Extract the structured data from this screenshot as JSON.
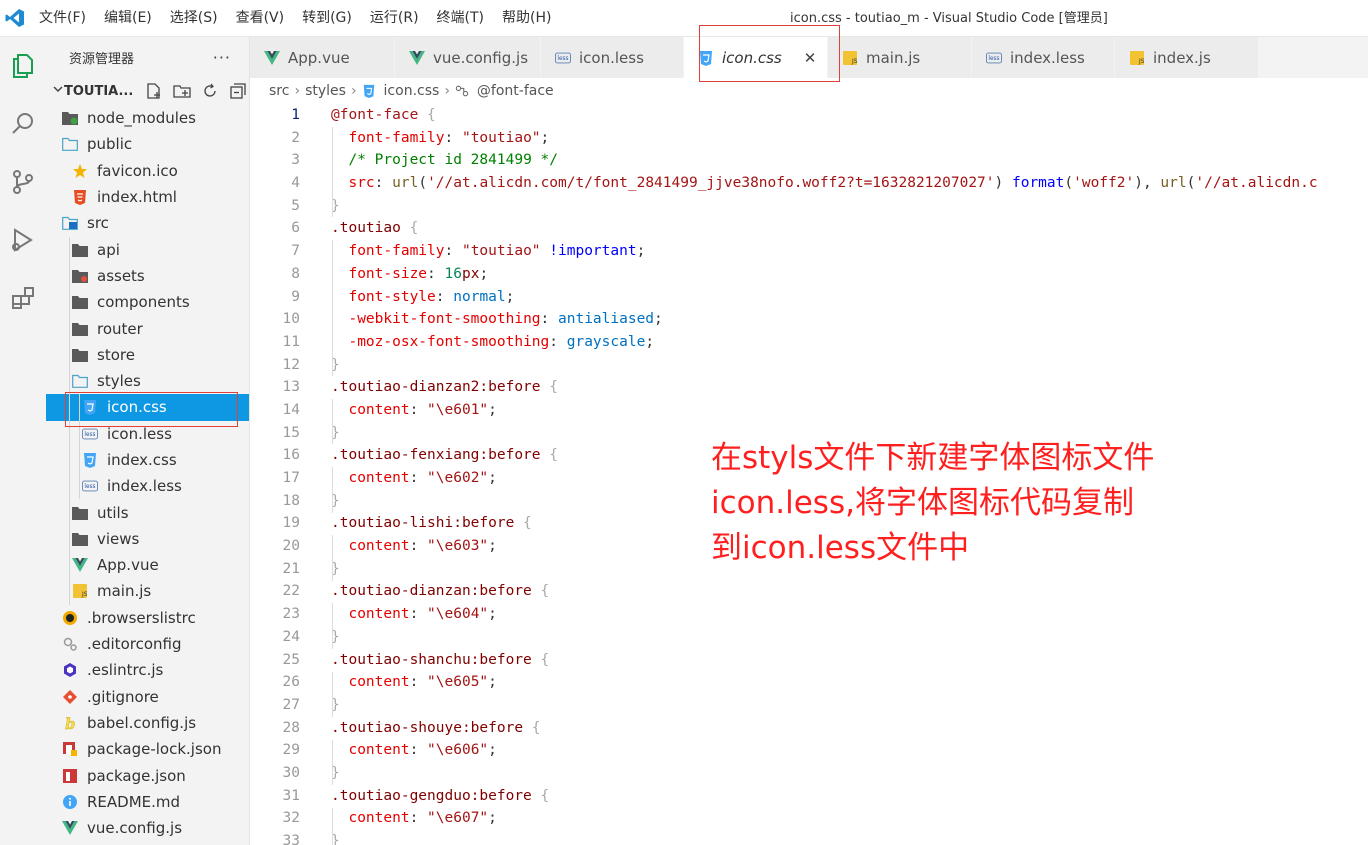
{
  "titlebar": {
    "menu": [
      "文件(F)",
      "编辑(E)",
      "选择(S)",
      "查看(V)",
      "转到(G)",
      "运行(R)",
      "终端(T)",
      "帮助(H)"
    ],
    "window_title": "icon.css - toutiao_m - Visual Studio Code [管理员]"
  },
  "activity": [
    "explorer-icon",
    "search-icon",
    "source-control-icon",
    "run-debug-icon",
    "extensions-icon"
  ],
  "sidebar": {
    "title": "资源管理器",
    "more": "···",
    "section": "TOUTIA...",
    "tree": [
      {
        "label": "node_modules",
        "icon": "folder-node",
        "depth": 0
      },
      {
        "label": "public",
        "icon": "folder-open",
        "depth": 0
      },
      {
        "label": "favicon.ico",
        "icon": "star",
        "depth": 1
      },
      {
        "label": "index.html",
        "icon": "html",
        "depth": 1
      },
      {
        "label": "src",
        "icon": "folder-src",
        "depth": 0
      },
      {
        "label": "api",
        "icon": "folder",
        "depth": 1
      },
      {
        "label": "assets",
        "icon": "folder-assets",
        "depth": 1
      },
      {
        "label": "components",
        "icon": "folder",
        "depth": 1
      },
      {
        "label": "router",
        "icon": "folder",
        "depth": 1
      },
      {
        "label": "store",
        "icon": "folder",
        "depth": 1
      },
      {
        "label": "styles",
        "icon": "folder-open",
        "depth": 1
      },
      {
        "label": "icon.css",
        "icon": "css",
        "depth": 2,
        "selected": true
      },
      {
        "label": "icon.less",
        "icon": "less",
        "depth": 2
      },
      {
        "label": "index.css",
        "icon": "css",
        "depth": 2
      },
      {
        "label": "index.less",
        "icon": "less",
        "depth": 2
      },
      {
        "label": "utils",
        "icon": "folder",
        "depth": 1
      },
      {
        "label": "views",
        "icon": "folder",
        "depth": 1
      },
      {
        "label": "App.vue",
        "icon": "vue",
        "depth": 1
      },
      {
        "label": "main.js",
        "icon": "js",
        "depth": 1
      },
      {
        "label": ".browserslistrc",
        "icon": "browserslist",
        "depth": 0
      },
      {
        "label": ".editorconfig",
        "icon": "editorconfig",
        "depth": 0
      },
      {
        "label": ".eslintrc.js",
        "icon": "eslint",
        "depth": 0
      },
      {
        "label": ".gitignore",
        "icon": "git",
        "depth": 0
      },
      {
        "label": "babel.config.js",
        "icon": "babel",
        "depth": 0
      },
      {
        "label": "package-lock.json",
        "icon": "npm-lock",
        "depth": 0
      },
      {
        "label": "package.json",
        "icon": "npm",
        "depth": 0
      },
      {
        "label": "README.md",
        "icon": "info",
        "depth": 0
      },
      {
        "label": "vue.config.js",
        "icon": "vue",
        "depth": 0
      }
    ]
  },
  "tabs": [
    {
      "label": "App.vue",
      "icon": "vue"
    },
    {
      "label": "vue.config.js",
      "icon": "vue"
    },
    {
      "label": "icon.less",
      "icon": "less"
    },
    {
      "label": "icon.css",
      "icon": "css",
      "active": true,
      "close": "✕"
    },
    {
      "label": "main.js",
      "icon": "js"
    },
    {
      "label": "index.less",
      "icon": "less"
    },
    {
      "label": "index.js",
      "icon": "js"
    }
  ],
  "breadcrumb": {
    "parts": [
      "src",
      "styles",
      "icon.css",
      "@font-face"
    ],
    "sep": "›"
  },
  "code": [
    [
      [
        "c-sel2",
        "@font-face"
      ],
      [
        "brace",
        " {"
      ]
    ],
    [
      [
        "c-pun",
        "  "
      ],
      [
        "c-prop",
        "font-family"
      ],
      [
        "c-pun",
        ": "
      ],
      [
        "c-str",
        "\"toutiao\""
      ],
      [
        "c-pun",
        ";"
      ]
    ],
    [
      [
        "c-pun",
        "  "
      ],
      [
        "c-cm",
        "/* Project id 2841499 */"
      ]
    ],
    [
      [
        "c-pun",
        "  "
      ],
      [
        "c-prop",
        "src"
      ],
      [
        "c-pun",
        ": "
      ],
      [
        "c-fn",
        "url"
      ],
      [
        "c-pun",
        "("
      ],
      [
        "c-str",
        "'//at.alicdn.com/t/font_2841499_jjve38nofo.woff2?t=1632821207027'"
      ],
      [
        "c-pun",
        ") "
      ],
      [
        "c-kw",
        "format"
      ],
      [
        "c-pun",
        "("
      ],
      [
        "c-str",
        "'woff2'"
      ],
      [
        "c-pun",
        "), "
      ],
      [
        "c-fn",
        "url"
      ],
      [
        "c-pun",
        "("
      ],
      [
        "c-str",
        "'//at.alicdn.c"
      ]
    ],
    [
      [
        "brace",
        "}"
      ]
    ],
    [
      [
        "c-sel",
        ".toutiao"
      ],
      [
        "brace",
        " {"
      ]
    ],
    [
      [
        "c-pun",
        "  "
      ],
      [
        "c-prop",
        "font-family"
      ],
      [
        "c-pun",
        ": "
      ],
      [
        "c-str",
        "\"toutiao\""
      ],
      [
        "c-kw",
        " !important"
      ],
      [
        "c-pun",
        ";"
      ]
    ],
    [
      [
        "c-pun",
        "  "
      ],
      [
        "c-prop",
        "font-size"
      ],
      [
        "c-pun",
        ": "
      ],
      [
        "c-num",
        "16"
      ],
      [
        "c-sel",
        "px"
      ],
      [
        "c-pun",
        ";"
      ]
    ],
    [
      [
        "c-pun",
        "  "
      ],
      [
        "c-prop",
        "font-style"
      ],
      [
        "c-pun",
        ": "
      ],
      [
        "c-vcol",
        "normal"
      ],
      [
        "c-pun",
        ";"
      ]
    ],
    [
      [
        "c-pun",
        "  "
      ],
      [
        "c-prop",
        "-webkit-font-smoothing"
      ],
      [
        "c-pun",
        ": "
      ],
      [
        "c-vcol",
        "antialiased"
      ],
      [
        "c-pun",
        ";"
      ]
    ],
    [
      [
        "c-pun",
        "  "
      ],
      [
        "c-prop",
        "-moz-osx-font-smoothing"
      ],
      [
        "c-pun",
        ": "
      ],
      [
        "c-vcol",
        "grayscale"
      ],
      [
        "c-pun",
        ";"
      ]
    ],
    [
      [
        "brace",
        "}"
      ]
    ],
    [
      [
        "c-sel",
        ".toutiao-dianzan2:before"
      ],
      [
        "brace",
        " {"
      ]
    ],
    [
      [
        "c-pun",
        "  "
      ],
      [
        "c-prop",
        "content"
      ],
      [
        "c-pun",
        ": "
      ],
      [
        "c-str",
        "\"\\e601\""
      ],
      [
        "c-pun",
        ";"
      ]
    ],
    [
      [
        "brace",
        "}"
      ]
    ],
    [
      [
        "c-sel",
        ".toutiao-fenxiang:before"
      ],
      [
        "brace",
        " {"
      ]
    ],
    [
      [
        "c-pun",
        "  "
      ],
      [
        "c-prop",
        "content"
      ],
      [
        "c-pun",
        ": "
      ],
      [
        "c-str",
        "\"\\e602\""
      ],
      [
        "c-pun",
        ";"
      ]
    ],
    [
      [
        "brace",
        "}"
      ]
    ],
    [
      [
        "c-sel",
        ".toutiao-lishi:before"
      ],
      [
        "brace",
        " {"
      ]
    ],
    [
      [
        "c-pun",
        "  "
      ],
      [
        "c-prop",
        "content"
      ],
      [
        "c-pun",
        ": "
      ],
      [
        "c-str",
        "\"\\e603\""
      ],
      [
        "c-pun",
        ";"
      ]
    ],
    [
      [
        "brace",
        "}"
      ]
    ],
    [
      [
        "c-sel",
        ".toutiao-dianzan:before"
      ],
      [
        "brace",
        " {"
      ]
    ],
    [
      [
        "c-pun",
        "  "
      ],
      [
        "c-prop",
        "content"
      ],
      [
        "c-pun",
        ": "
      ],
      [
        "c-str",
        "\"\\e604\""
      ],
      [
        "c-pun",
        ";"
      ]
    ],
    [
      [
        "brace",
        "}"
      ]
    ],
    [
      [
        "c-sel",
        ".toutiao-shanchu:before"
      ],
      [
        "brace",
        " {"
      ]
    ],
    [
      [
        "c-pun",
        "  "
      ],
      [
        "c-prop",
        "content"
      ],
      [
        "c-pun",
        ": "
      ],
      [
        "c-str",
        "\"\\e605\""
      ],
      [
        "c-pun",
        ";"
      ]
    ],
    [
      [
        "brace",
        "}"
      ]
    ],
    [
      [
        "c-sel",
        ".toutiao-shouye:before"
      ],
      [
        "brace",
        " {"
      ]
    ],
    [
      [
        "c-pun",
        "  "
      ],
      [
        "c-prop",
        "content"
      ],
      [
        "c-pun",
        ": "
      ],
      [
        "c-str",
        "\"\\e606\""
      ],
      [
        "c-pun",
        ";"
      ]
    ],
    [
      [
        "brace",
        "}"
      ]
    ],
    [
      [
        "c-sel",
        ".toutiao-gengduo:before"
      ],
      [
        "brace",
        " {"
      ]
    ],
    [
      [
        "c-pun",
        "  "
      ],
      [
        "c-prop",
        "content"
      ],
      [
        "c-pun",
        ": "
      ],
      [
        "c-str",
        "\"\\e607\""
      ],
      [
        "c-pun",
        ";"
      ]
    ],
    [
      [
        "brace",
        "}"
      ]
    ]
  ],
  "annotation": {
    "lines": [
      "在styls文件下新建字体图标文件",
      "icon.less,将字体图标代码复制",
      "到icon.less文件中"
    ],
    "color": "#ff1f1f"
  },
  "colors": {
    "accent": "#0e98e3",
    "highlight_box": "#e0403a"
  }
}
